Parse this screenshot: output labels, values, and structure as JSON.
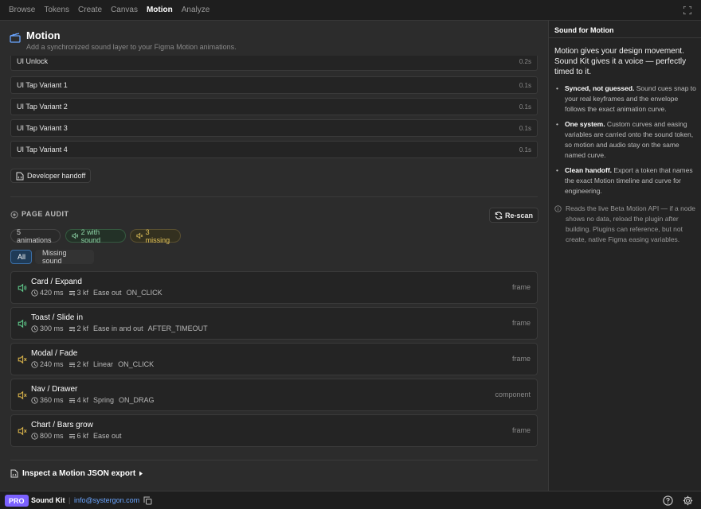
{
  "nav": {
    "tabs": [
      "Browse",
      "Tokens",
      "Create",
      "Canvas",
      "Motion",
      "Analyze"
    ],
    "active": "Motion"
  },
  "header": {
    "title": "Motion",
    "subtitle": "Add a synchronized sound layer to your Figma Motion animations."
  },
  "tokens": [
    {
      "name": "UI Unlock",
      "duration": "0.2s"
    },
    {
      "name": "UI Tap Variant 1",
      "duration": "0.1s"
    },
    {
      "name": "UI Tap Variant 2",
      "duration": "0.1s"
    },
    {
      "name": "UI Tap Variant 3",
      "duration": "0.1s"
    },
    {
      "name": "UI Tap Variant 4",
      "duration": "0.1s"
    }
  ],
  "handoff_label": "Developer handoff",
  "audit": {
    "title": "PAGE AUDIT",
    "rescan_label": "Re-scan",
    "chips": {
      "total": "5 animations",
      "with_sound": "2 with sound",
      "missing": "3 missing"
    },
    "filters": {
      "all": "All",
      "missing": "Missing sound",
      "active": "All"
    },
    "items": [
      {
        "name": "Card / Expand",
        "duration": "420 ms",
        "keyframes": "3 kf",
        "easing": "Ease out",
        "trigger": "ON_CLICK",
        "kind": "frame",
        "has_sound": true
      },
      {
        "name": "Toast / Slide in",
        "duration": "300 ms",
        "keyframes": "2 kf",
        "easing": "Ease in and out",
        "trigger": "AFTER_TIMEOUT",
        "kind": "frame",
        "has_sound": true
      },
      {
        "name": "Modal / Fade",
        "duration": "240 ms",
        "keyframes": "2 kf",
        "easing": "Linear",
        "trigger": "ON_CLICK",
        "kind": "frame",
        "has_sound": false
      },
      {
        "name": "Nav / Drawer",
        "duration": "360 ms",
        "keyframes": "4 kf",
        "easing": "Spring",
        "trigger": "ON_DRAG",
        "kind": "component",
        "has_sound": false
      },
      {
        "name": "Chart / Bars grow",
        "duration": "800 ms",
        "keyframes": "6 kf",
        "easing": "Ease out",
        "trigger": "",
        "kind": "frame",
        "has_sound": false
      }
    ]
  },
  "inspect_label": "Inspect a Motion JSON export",
  "side": {
    "heading": "Sound for Motion",
    "intro": "Motion gives your design movement. Sound Kit gives it a voice — perfectly timed to it.",
    "bullets": [
      {
        "bold": "Synced, not guessed.",
        "text": " Sound cues snap to your real keyframes and the envelope follows the exact animation curve."
      },
      {
        "bold": "One system.",
        "text": " Custom curves and easing variables are carried onto the sound token, so motion and audio stay on the same named curve."
      },
      {
        "bold": "Clean handoff.",
        "text": " Export a token that names the exact Motion timeline and curve for engineering."
      }
    ],
    "note": "Reads the live Beta Motion API — if a node shows no data, reload the plugin after building. Plugins can reference, but not create, native Figma easing variables."
  },
  "footer": {
    "badge": "PRO",
    "app_name": "Sound Kit",
    "separator": "|",
    "email": "info@systergon.com"
  },
  "colors": {
    "accent": "#7b61ff",
    "sound_on": "#5fc98a",
    "sound_off": "#d9b34a",
    "link": "#6aa5ff"
  }
}
